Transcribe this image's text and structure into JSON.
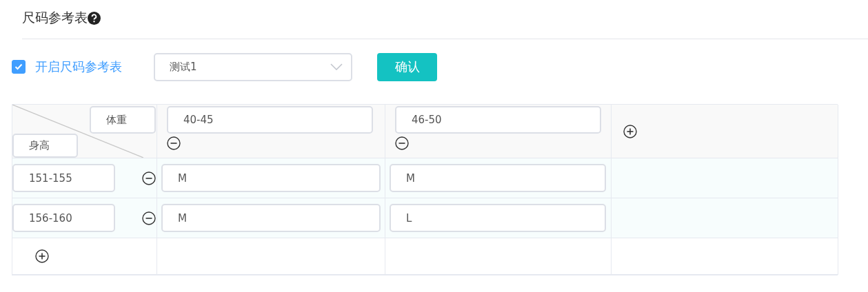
{
  "title": "尺码参考表",
  "enable": {
    "label": "开启尺码参考表",
    "checked": true
  },
  "template_select": {
    "value": "测试1"
  },
  "confirm_button": "确认",
  "table": {
    "corner": {
      "column_label": "体重",
      "row_label": "身高"
    },
    "weight_columns": [
      {
        "value": "40-45"
      },
      {
        "value": "46-50"
      }
    ],
    "rows": [
      {
        "height": "151-155",
        "sizes": [
          "M",
          "M"
        ]
      },
      {
        "height": "156-160",
        "sizes": [
          "M",
          "L"
        ]
      }
    ]
  }
}
